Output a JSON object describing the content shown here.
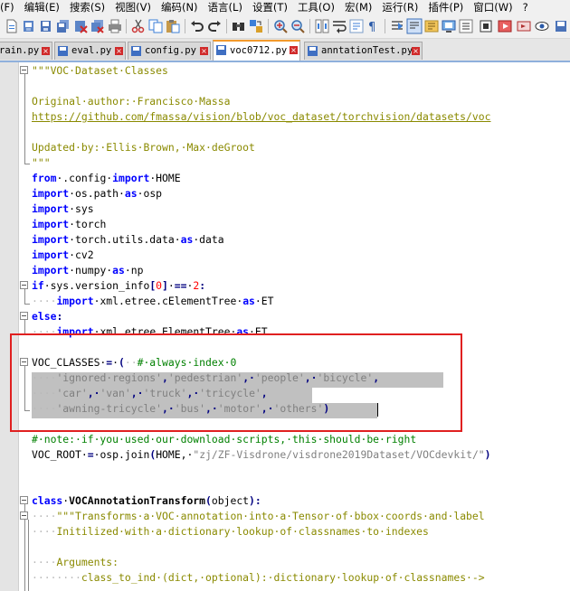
{
  "menu": [
    "(F)",
    "编辑(E)",
    "搜索(S)",
    "视图(V)",
    "编码(N)",
    "语言(L)",
    "设置(T)",
    "工具(O)",
    "宏(M)",
    "运行(R)",
    "插件(P)",
    "窗口(W)",
    "?"
  ],
  "toolbar_icons": [
    "new-icon",
    "open-icon",
    "save-icon",
    "save-all-icon",
    "close-icon",
    "close-all-icon",
    "print-icon",
    "cut-icon",
    "copy-icon",
    "paste-icon",
    "undo-icon",
    "redo-icon",
    "find-icon",
    "replace-icon",
    "zoom-in-icon",
    "zoom-out-icon",
    "sync-scroll-icon",
    "word-wrap-icon",
    "show-all-chars-icon",
    "indent-guide-icon",
    "user-lang-icon",
    "doc-map-icon",
    "function-list-icon",
    "monitor-icon"
  ],
  "tabs": [
    {
      "label": "rain.py",
      "active": false
    },
    {
      "label": "eval.py",
      "active": false
    },
    {
      "label": "config.py",
      "active": false
    },
    {
      "label": "voc0712.py",
      "active": true
    },
    {
      "label": "anntationTest.py",
      "active": false
    }
  ],
  "colors": {
    "keyword": "#0000ff",
    "docstring": "#8a8a00",
    "string": "#808080",
    "comment": "#008000",
    "number": "#ff0000",
    "active_tab_accent": "#f39a2c",
    "highlight_box": "#e02020"
  },
  "code": {
    "l1": "\"\"\"VOC·Dataset·Classes",
    "l3": "Original·author:·Francisco·Massa",
    "l4": "https://github.com/fmassa/vision/blob/voc_dataset/torchvision/datasets/voc",
    "l6": "Updated·by:·Ellis·Brown,·Max·deGroot",
    "l7": "\"\"\"",
    "l8a": "from",
    "l8b": "·.config·",
    "l8c": "import",
    "l8d": "·HOME",
    "l9a": "import",
    "l9b": "·os.path·",
    "l9c": "as",
    "l9d": "·osp",
    "l10a": "import",
    "l10b": "·sys",
    "l11a": "import",
    "l11b": "·torch",
    "l12a": "import",
    "l12b": "·torch.utils.data·",
    "l12c": "as",
    "l12d": "·data",
    "l13a": "import",
    "l13b": "·cv2",
    "l14a": "import",
    "l14b": "·numpy·",
    "l14c": "as",
    "l14d": "·np",
    "l15a": "if",
    "l15b": "·sys.version_info",
    "l15c": "[",
    "l15d": "0",
    "l15e": "]",
    "l15f": "·",
    "l15g": "==",
    "l15h": "·",
    "l15i": "2",
    "l15j": ":",
    "l16ws": "····",
    "l16a": "import",
    "l16b": "·xml.etree.cElementTree·",
    "l16c": "as",
    "l16d": "·ET",
    "l17a": "else",
    "l17b": ":",
    "l18ws": "····",
    "l18a": "import",
    "l18b": "·xml.etree.ElementTree·",
    "l18c": "as",
    "l18d": "·ET",
    "l20a": "VOC_CLASSES·",
    "l20b": "=",
    "l20c": "·",
    "l20d": "(",
    "l20e": "··",
    "l20f": "#·always·index·0",
    "l21ws": "····",
    "l21a": "'ignored·regions'",
    "l21b": ",",
    "l21c": "'pedestrian'",
    "l21d": ",·",
    "l21e": "'people'",
    "l21f": ",·",
    "l21g": "'bicycle'",
    "l21h": ",",
    "l22ws": "····",
    "l22a": "'car'",
    "l22b": ",·",
    "l22c": "'van'",
    "l22d": ",·",
    "l22e": "'truck'",
    "l22f": ",·",
    "l22g": "'tricycle'",
    "l22h": ",",
    "l23ws": "····",
    "l23a": "'awning-tricycle'",
    "l23b": ",·",
    "l23c": "'bus'",
    "l23d": ",·",
    "l23e": "'motor'",
    "l23f": ",·",
    "l23g": "'others'",
    "l23h": ")",
    "l25": "#·note:·if·you·used·our·download·scripts,·this·should·be·right",
    "l26a": "VOC_ROOT·",
    "l26b": "=",
    "l26c": "·osp.join",
    "l26d": "(",
    "l26e": "HOME,·",
    "l26f": "\"zj/ZF-Visdrone/visdrone2019Dataset/VOCdevkit/\"",
    "l26g": ")",
    "l29a": "class",
    "l29b": "·",
    "l29c": "VOCAnnotationTransform",
    "l29d": "(",
    "l29e": "object",
    "l29f": "):",
    "l30ws": "····",
    "l30a": "\"\"\"Transforms·a·VOC·annotation·into·a·Tensor·of·bbox·coords·and·label",
    "l31ws": "····",
    "l31a": "Initilized·with·a·dictionary·lookup·of·classnames·to·indexes",
    "l33ws": "····",
    "l33a": "Arguments:",
    "l34ws": "········",
    "l34a": "class_to_ind·(dict,·optional):·dictionary·lookup·of·classnames·->"
  }
}
